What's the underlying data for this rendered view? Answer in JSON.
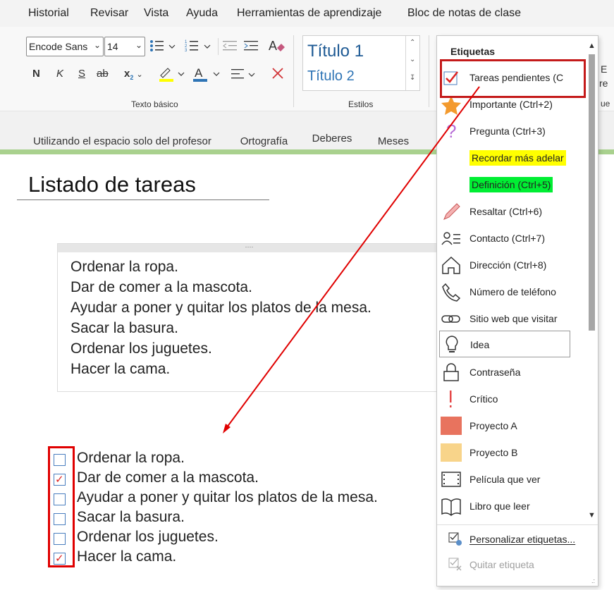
{
  "menu": [
    "Historial",
    "Revisar",
    "Vista",
    "Ayuda",
    "Herramientas de aprendizaje",
    "Bloc de notas de clase"
  ],
  "ribbon": {
    "font_name": "Encode Sans",
    "font_size": "14",
    "bold": "N",
    "italic": "K",
    "underline": "S",
    "strike": "ab",
    "subscript": "x",
    "subscript_small": "2",
    "texto_basico_label": "Texto básico",
    "styles": {
      "titulo1": "Título 1",
      "titulo2": "Título 2",
      "label": "Estilos"
    }
  },
  "tabs": [
    {
      "label": "Utilizando el espacio solo del profesor",
      "color": "#b8dba0"
    },
    {
      "label": "Ortografía",
      "color": "#f2b4b4"
    },
    {
      "label": "Deberes",
      "color": "#c5e6b0"
    },
    {
      "label": "Meses",
      "color": "#8fd3a0"
    }
  ],
  "page": {
    "title": "Listado de tareas",
    "note_lines": [
      "Ordenar la ropa.",
      "Dar de comer a la mascota.",
      "Ayudar a poner y quitar los platos de la mesa.",
      "Sacar la basura.",
      "Ordenar los juguetes.",
      "Hacer la cama."
    ],
    "todo": [
      {
        "text": "Ordenar la ropa.",
        "checked": false
      },
      {
        "text": "Dar de comer a la mascota.",
        "checked": true
      },
      {
        "text": "Ayudar a poner y quitar los platos de la mesa.",
        "checked": false
      },
      {
        "text": "Sacar la basura.",
        "checked": false
      },
      {
        "text": "Ordenar los juguetes.",
        "checked": false
      },
      {
        "text": "Hacer la cama.",
        "checked": true
      }
    ]
  },
  "tags_menu": {
    "header": "Etiquetas",
    "items": [
      {
        "label": "Tareas pendientes (C",
        "icon": "checkbox-icon"
      },
      {
        "label": "Importante (Ctrl+2)",
        "icon": "star-icon"
      },
      {
        "label": "Pregunta (Ctrl+3)",
        "icon": "question-icon"
      },
      {
        "label": "Recordar más adelar",
        "icon": "highlight-yellow",
        "bg": "#ffff00"
      },
      {
        "label": "Definición (Ctrl+5)",
        "icon": "highlight-green",
        "bg": "#00ee33"
      },
      {
        "label": "Resaltar (Ctrl+6)",
        "icon": "pen-icon"
      },
      {
        "label": "Contacto (Ctrl+7)",
        "icon": "contact-icon"
      },
      {
        "label": "Dirección (Ctrl+8)",
        "icon": "house-icon"
      },
      {
        "label": "Número de teléfono",
        "icon": "phone-icon"
      },
      {
        "label": "Sitio web que visitar",
        "icon": "link-icon"
      },
      {
        "label": "Idea",
        "icon": "lightbulb-icon"
      },
      {
        "label": "Contraseña",
        "icon": "lock-icon"
      },
      {
        "label": "Crítico",
        "icon": "exclamation-icon"
      },
      {
        "label": "Proyecto A",
        "icon": "project-a-icon",
        "bg": "#e8735e"
      },
      {
        "label": "Proyecto B",
        "icon": "project-b-icon",
        "bg": "#f8d48a"
      },
      {
        "label": "Película que ver",
        "icon": "film-icon"
      },
      {
        "label": "Libro que leer",
        "icon": "book-icon"
      }
    ],
    "footer": [
      {
        "label": "Personalizar etiquetas...",
        "icon": "customize-tags-icon",
        "enabled": true
      },
      {
        "label": "Quitar etiqueta",
        "icon": "remove-tag-icon",
        "enabled": false
      }
    ]
  },
  "right_edge": {
    "a": "E",
    "b": "re",
    "c": "ue"
  },
  "colors": {
    "annotation_red": "#e00000",
    "highlight_yellow": "#ffff00",
    "highlight_green": "#00ee33"
  }
}
